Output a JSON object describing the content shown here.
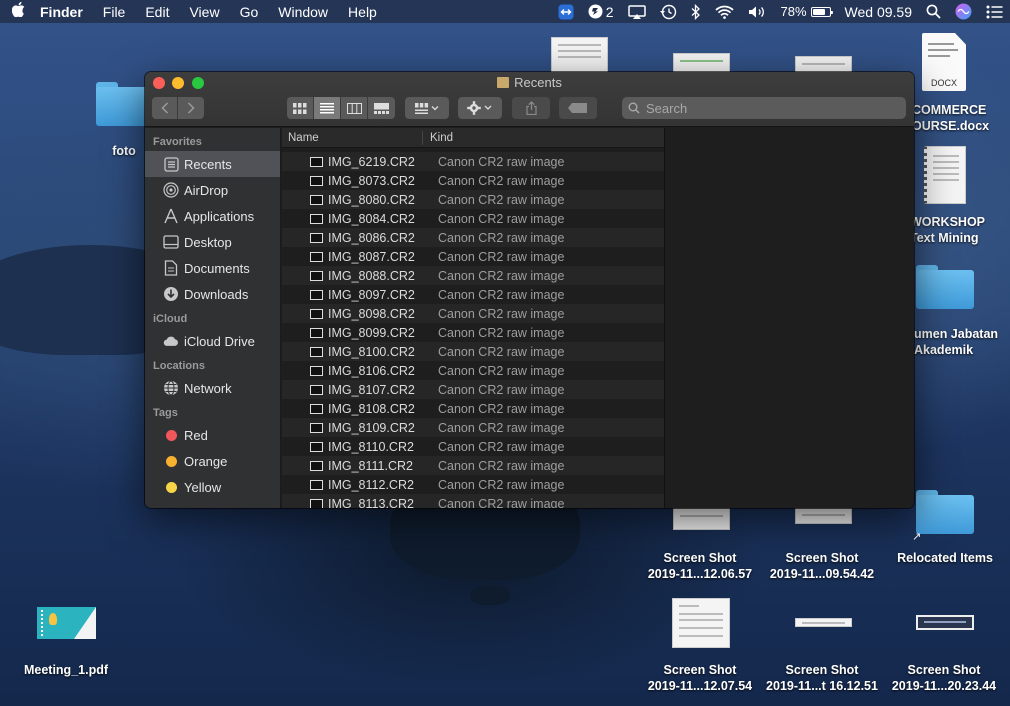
{
  "menubar": {
    "app": "Finder",
    "menus": [
      "File",
      "Edit",
      "View",
      "Go",
      "Window",
      "Help"
    ],
    "notification_badge": "2",
    "battery": "78%",
    "battery_level": 0.78,
    "clock": "Wed 09.59"
  },
  "desktop": {
    "icons": [
      {
        "label": "foto"
      },
      {
        "label": "COMMERCE"
      },
      {
        "label": "OURSE.docx"
      },
      {
        "label": "WORKSHOP"
      },
      {
        "label": "Text Mining"
      },
      {
        "label": "umen Jabatan"
      },
      {
        "label": "Akademik"
      },
      {
        "label": "Relocated Items"
      },
      {
        "label": "Meeting_1.pdf"
      },
      {
        "label": "DOCX"
      }
    ],
    "screenshots": [
      {
        "line1": "Screen Shot",
        "line2": "2019-11...12.06.57"
      },
      {
        "line1": "Screen Shot",
        "line2": "2019-11...09.54.42"
      },
      {
        "line1": "Screen Shot",
        "line2": "2019-11...12.07.54"
      },
      {
        "line1": "Screen Shot",
        "line2": "2019-11...t 16.12.51"
      },
      {
        "line1": "Screen Shot",
        "line2": "2019-11...20.23.44"
      }
    ]
  },
  "finder": {
    "title": "Recents",
    "search_placeholder": "Search",
    "sidebar": {
      "favorites_header": "Favorites",
      "favorites": [
        "Recents",
        "AirDrop",
        "Applications",
        "Desktop",
        "Documents",
        "Downloads"
      ],
      "icloud_header": "iCloud",
      "icloud": [
        "iCloud Drive"
      ],
      "locations_header": "Locations",
      "locations": [
        "Network"
      ],
      "tags_header": "Tags",
      "tags": [
        {
          "label": "Red",
          "color": "#f0575b"
        },
        {
          "label": "Orange",
          "color": "#f7b030"
        },
        {
          "label": "Yellow",
          "color": "#f5d547"
        }
      ]
    },
    "columns": {
      "name": "Name",
      "kind": "Kind"
    },
    "files": [
      {
        "name": "IMG_6219.CR2",
        "kind": "Canon CR2 raw image"
      },
      {
        "name": "IMG_8073.CR2",
        "kind": "Canon CR2 raw image"
      },
      {
        "name": "IMG_8080.CR2",
        "kind": "Canon CR2 raw image"
      },
      {
        "name": "IMG_8084.CR2",
        "kind": "Canon CR2 raw image"
      },
      {
        "name": "IMG_8086.CR2",
        "kind": "Canon CR2 raw image"
      },
      {
        "name": "IMG_8087.CR2",
        "kind": "Canon CR2 raw image"
      },
      {
        "name": "IMG_8088.CR2",
        "kind": "Canon CR2 raw image"
      },
      {
        "name": "IMG_8097.CR2",
        "kind": "Canon CR2 raw image"
      },
      {
        "name": "IMG_8098.CR2",
        "kind": "Canon CR2 raw image"
      },
      {
        "name": "IMG_8099.CR2",
        "kind": "Canon CR2 raw image"
      },
      {
        "name": "IMG_8100.CR2",
        "kind": "Canon CR2 raw image"
      },
      {
        "name": "IMG_8106.CR2",
        "kind": "Canon CR2 raw image"
      },
      {
        "name": "IMG_8107.CR2",
        "kind": "Canon CR2 raw image"
      },
      {
        "name": "IMG_8108.CR2",
        "kind": "Canon CR2 raw image"
      },
      {
        "name": "IMG_8109.CR2",
        "kind": "Canon CR2 raw image"
      },
      {
        "name": "IMG_8110.CR2",
        "kind": "Canon CR2 raw image"
      },
      {
        "name": "IMG_8111.CR2",
        "kind": "Canon CR2 raw image"
      },
      {
        "name": "IMG_8112.CR2",
        "kind": "Canon CR2 raw image"
      },
      {
        "name": "IMG_8113.CR2",
        "kind": "Canon CR2 raw image"
      }
    ]
  }
}
